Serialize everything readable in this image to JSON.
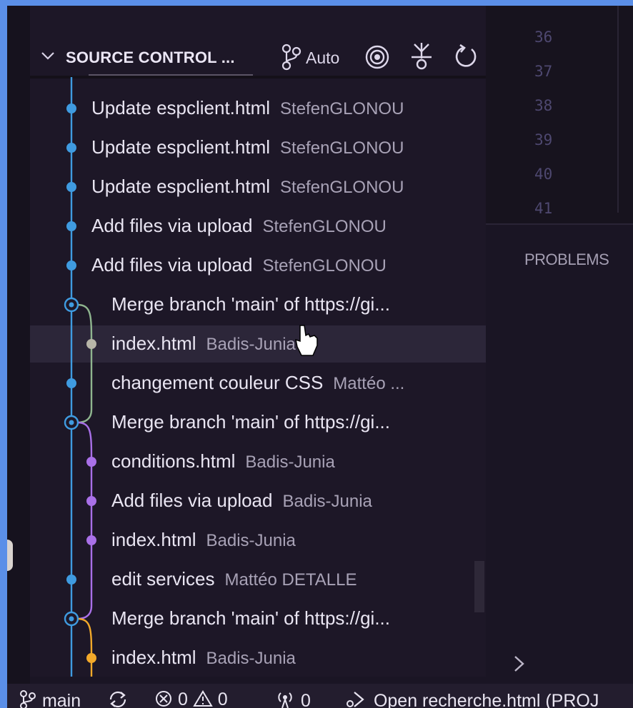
{
  "header": {
    "title": "SOURCE CONTROL ...",
    "auto_label": "Auto"
  },
  "commits": [
    {
      "message": "Update espclient.html",
      "author": "StefenGLONOU"
    },
    {
      "message": "Update espclient.html",
      "author": "StefenGLONOU"
    },
    {
      "message": "Update espclient.html",
      "author": "StefenGLONOU"
    },
    {
      "message": "Add files via upload",
      "author": "StefenGLONOU"
    },
    {
      "message": "Add files via upload",
      "author": "StefenGLONOU"
    },
    {
      "message": "Merge branch 'main' of https://gi...",
      "author": ""
    },
    {
      "message": "index.html",
      "author": "Badis-Junia"
    },
    {
      "message": "changement couleur CSS",
      "author": "Mattéo ..."
    },
    {
      "message": "Merge branch 'main' of https://gi...",
      "author": ""
    },
    {
      "message": "conditions.html",
      "author": "Badis-Junia"
    },
    {
      "message": "Add files via upload",
      "author": "Badis-Junia"
    },
    {
      "message": "index.html",
      "author": "Badis-Junia"
    },
    {
      "message": "edit services",
      "author": "Mattéo DETALLE"
    },
    {
      "message": "Merge branch 'main' of https://gi...",
      "author": ""
    },
    {
      "message": "index.html",
      "author": "Badis-Junia"
    }
  ],
  "line_numbers": [
    "36",
    "37",
    "38",
    "39",
    "40",
    "41"
  ],
  "panel": {
    "problems_tab": "PROBLEMS"
  },
  "status_bar": {
    "branch": "main",
    "errors": "0",
    "warnings": "0",
    "ports": "0",
    "open_file": "Open recherche.html (PROJ"
  },
  "colors": {
    "graph_blue": "#3f9be0",
    "graph_purple": "#a970e8",
    "graph_orange": "#f2a92a",
    "graph_green": "#8fb58f"
  }
}
